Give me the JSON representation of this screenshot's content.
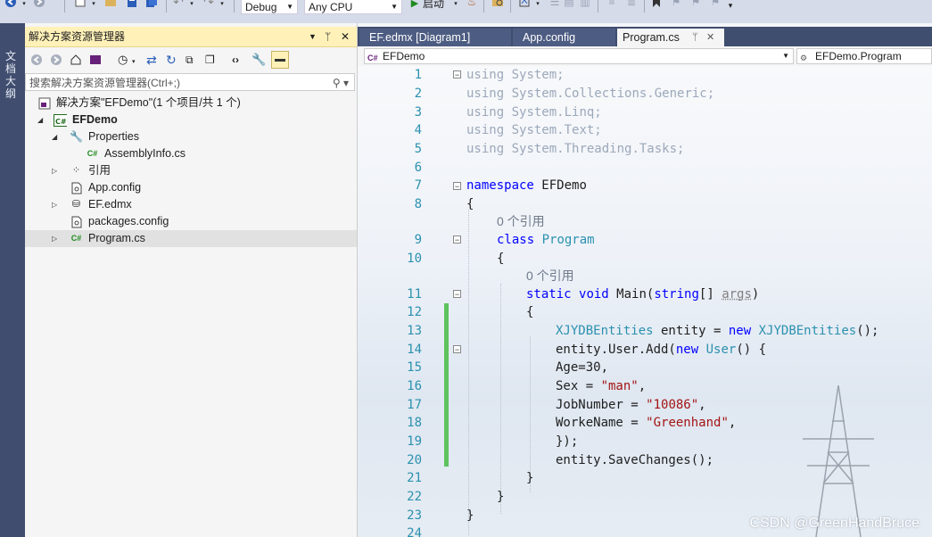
{
  "toolbar": {
    "config": "Debug",
    "platform": "Any CPU",
    "start": "启动"
  },
  "left_strip": {
    "label": "文档大纲"
  },
  "solution_explorer": {
    "title": "解决方案资源管理器",
    "search_placeholder": "搜索解决方案资源管理器(Ctrl+;)",
    "tree": [
      {
        "label": "解决方案\"EFDemo\"(1 个项目/共 1 个)",
        "icon": "solution-icon",
        "level": 0,
        "expand": ""
      },
      {
        "label": "EFDemo",
        "icon": "csharp-project-icon",
        "level": 0,
        "expand": "open",
        "bold": true
      },
      {
        "label": "Properties",
        "icon": "wrench-icon",
        "level": 1,
        "expand": "open"
      },
      {
        "label": "AssemblyInfo.cs",
        "icon": "csharp-file-icon",
        "level": 2,
        "expand": ""
      },
      {
        "label": "引用",
        "icon": "references-icon",
        "level": 1,
        "expand": "closed"
      },
      {
        "label": "App.config",
        "icon": "config-file-icon",
        "level": 1,
        "expand": ""
      },
      {
        "label": "EF.edmx",
        "icon": "edmx-icon",
        "level": 1,
        "expand": "closed"
      },
      {
        "label": "packages.config",
        "icon": "config-file-icon",
        "level": 1,
        "expand": ""
      },
      {
        "label": "Program.cs",
        "icon": "csharp-file-icon",
        "level": 1,
        "expand": "closed",
        "selected": true
      }
    ]
  },
  "editor": {
    "tabs": [
      {
        "label": "EF.edmx [Diagram1]",
        "active": false
      },
      {
        "label": "App.config",
        "active": false
      },
      {
        "label": "Program.cs",
        "active": true
      }
    ],
    "nav_left": "EFDemo",
    "nav_right": "EFDemo.Program",
    "references_label": "0 个引用",
    "watermark": "CSDN @GreenHandBruce",
    "lines": [
      {
        "n": "1"
      },
      {
        "n": "2"
      },
      {
        "n": "3"
      },
      {
        "n": "4"
      },
      {
        "n": "5"
      },
      {
        "n": "6"
      },
      {
        "n": "7"
      },
      {
        "n": "8"
      },
      {
        "n": "9"
      },
      {
        "n": "10"
      },
      {
        "n": "11"
      },
      {
        "n": "12"
      },
      {
        "n": "13"
      },
      {
        "n": "14"
      },
      {
        "n": "15"
      },
      {
        "n": "16"
      },
      {
        "n": "17"
      },
      {
        "n": "18"
      },
      {
        "n": "19"
      },
      {
        "n": "20"
      },
      {
        "n": "21"
      },
      {
        "n": "22"
      },
      {
        "n": "23"
      },
      {
        "n": "24"
      }
    ],
    "code": {
      "l1": "System;",
      "l2": "System.Collections.Generic;",
      "l3": "System.Linq;",
      "l4": "System.Text;",
      "l5": "System.Threading.Tasks;",
      "using": "using",
      "namespace": "namespace",
      "ns": "EFDemo",
      "open": "{",
      "close": "}",
      "class": "class",
      "program": "Program",
      "static": "static",
      "void": "void",
      "main": "Main(",
      "string": "string",
      "args_pre": "[] ",
      "args": "args",
      "args_post": ")",
      "ent_type": "XJYDBEntities",
      "ent_var": " entity = ",
      "new": "new",
      "ent_end": "();",
      "add_pre": "entity.User.Add(",
      "user": "User",
      "add_end": "() {",
      "age": "Age=30,",
      "sex_pre": "Sex = ",
      "sex": "\"man\"",
      "comma": ",",
      "job_pre": "JobNumber = ",
      "job": "\"10086\"",
      "work_pre": "WorkeName = ",
      "work": "\"Greenhand\"",
      "end_add": "});",
      "save": "entity.SaveChanges();"
    }
  }
}
